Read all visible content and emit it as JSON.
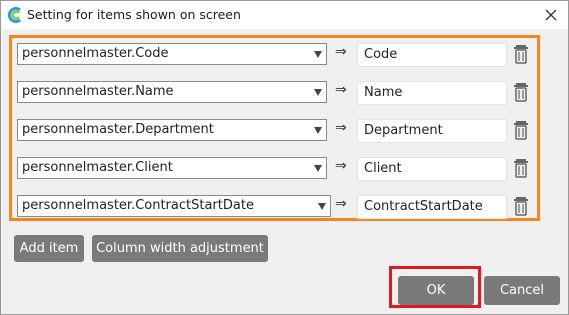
{
  "window": {
    "title": "Setting for items shown on screen"
  },
  "rows": [
    {
      "column": "personnelmaster.Code",
      "label": "Code"
    },
    {
      "column": "personnelmaster.Name",
      "label": "Name"
    },
    {
      "column": "personnelmaster.Department",
      "label": "Department"
    },
    {
      "column": "personnelmaster.Client",
      "label": "Client"
    },
    {
      "column": "personnelmaster.ContractStartDate",
      "label": "ContractStartDate"
    }
  ],
  "arrow_symbol": "⇒",
  "buttons": {
    "add_item": "Add item",
    "column_width": "Column width adjustment",
    "ok": "OK",
    "cancel": "Cancel"
  },
  "colors": {
    "accent_orange": "#f5861f",
    "highlight_red": "#e01b1b",
    "button_gray": "#7a7a7a"
  }
}
